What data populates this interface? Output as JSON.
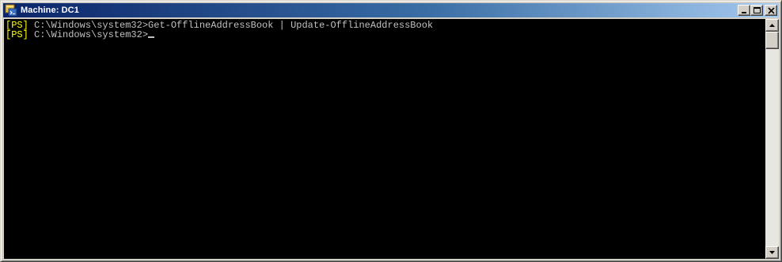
{
  "window": {
    "title": "Machine: DC1",
    "icon": "powershell-console-icon",
    "buttons": [
      "minimize-icon",
      "maximize-icon",
      "close-icon"
    ]
  },
  "console": {
    "lines": [
      {
        "prompt_tag": "[PS]",
        "text": " C:\\Windows\\system32>Get-OfflineAddressBook | Update-OfflineAddressBook"
      },
      {
        "prompt_tag": "[PS]",
        "text": " C:\\Windows\\system32>"
      }
    ]
  },
  "colors": {
    "console_background": "#000000",
    "console_text": "#c0c0c0",
    "prompt_tag": "#ffff00",
    "titlebar_start": "#0a246a",
    "titlebar_end": "#a6caf0"
  }
}
